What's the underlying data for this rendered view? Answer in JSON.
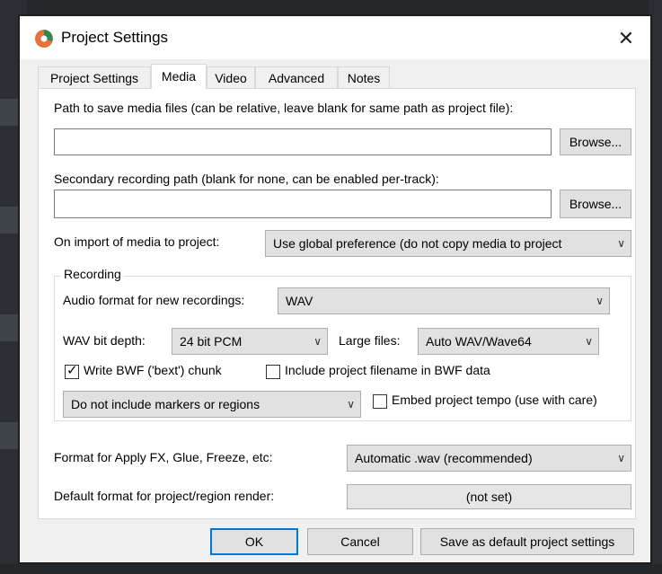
{
  "window": {
    "title": "Project Settings",
    "close_glyph": "✕"
  },
  "tabs": [
    {
      "label": "Project Settings",
      "active": false
    },
    {
      "label": "Media",
      "active": true
    },
    {
      "label": "Video",
      "active": false
    },
    {
      "label": "Advanced",
      "active": false
    },
    {
      "label": "Notes",
      "active": false
    }
  ],
  "media": {
    "save_path_label": "Path to save media files (can be relative, leave blank for same path as project file):",
    "save_path_value": "",
    "browse_label": "Browse...",
    "secondary_label": "Secondary recording path (blank for none, can be enabled per-track):",
    "secondary_value": "",
    "import_label": "On import of media to project:",
    "import_value": "Use global preference (do not copy media to project"
  },
  "recording": {
    "group_title": "Recording",
    "audio_format_label": "Audio format for new recordings:",
    "audio_format_value": "WAV",
    "bit_depth_label": "WAV bit depth:",
    "bit_depth_value": "24 bit PCM",
    "large_files_label": "Large files:",
    "large_files_value": "Auto WAV/Wave64",
    "bwf_label": "Write BWF ('bext') chunk",
    "bwf_checked": true,
    "include_filename_label": "Include project filename in BWF data",
    "include_filename_checked": false,
    "markers_value": "Do not include markers or regions",
    "embed_tempo_label": "Embed project tempo (use with care)",
    "embed_tempo_checked": false
  },
  "apply_fx": {
    "label": "Format for Apply FX, Glue, Freeze, etc:",
    "value": "Automatic .wav (recommended)"
  },
  "render": {
    "label": "Default format for project/region render:",
    "value": "(not set)"
  },
  "footer": {
    "ok_label": "OK",
    "cancel_label": "Cancel",
    "save_default_label": "Save as default project settings"
  },
  "icons": {
    "app_logo": "reaper-logo-icon",
    "dropdown": "chevron-down-icon",
    "check": "✓"
  },
  "colors": {
    "accent": "#0078d7",
    "logo_orange": "#e8703a",
    "logo_green": "#2a8a5a"
  }
}
